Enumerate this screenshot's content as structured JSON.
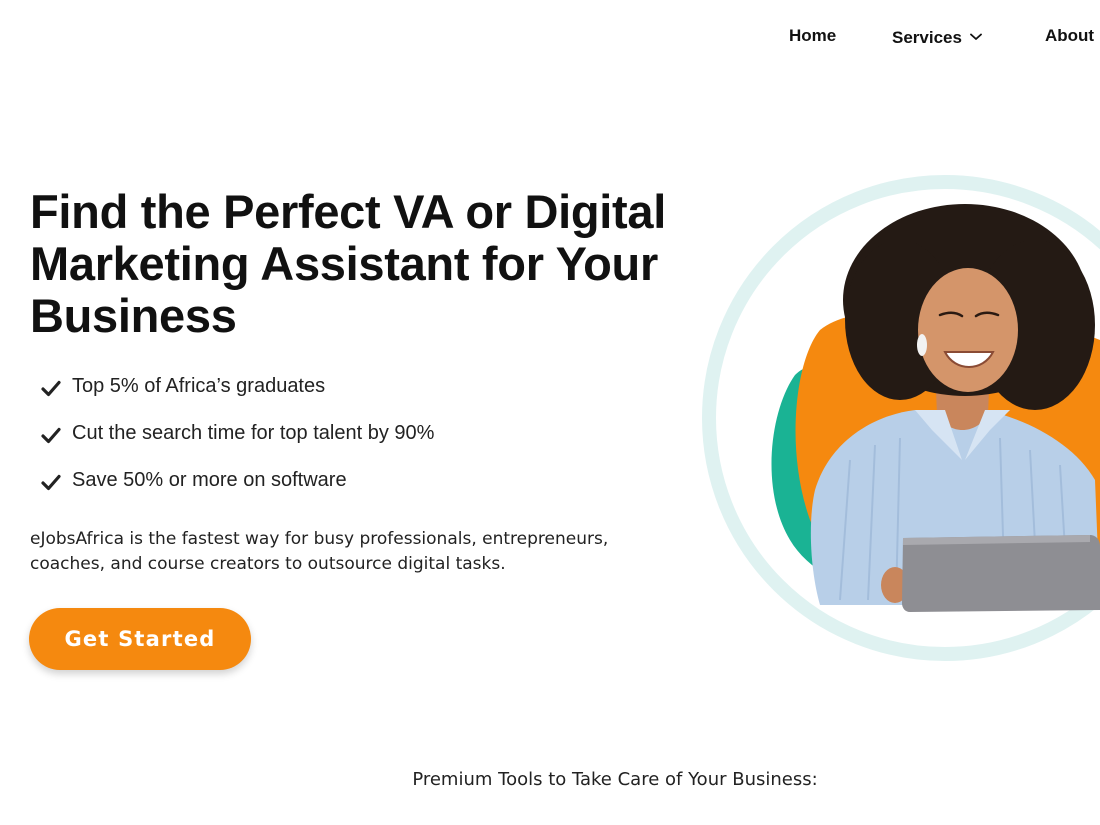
{
  "nav": {
    "items": [
      {
        "label": "Home"
      },
      {
        "label": "Services"
      },
      {
        "label": "About"
      }
    ],
    "services_icon": "chevron-down-icon"
  },
  "hero": {
    "headline_lines": [
      "Find the Perfect VA or Digital",
      "Marketing Assistant for Your",
      "Business"
    ],
    "features": [
      "Top 5% of Africa’s graduates",
      "Cut the search time for top talent by 90%",
      "Save 50% or more on software"
    ],
    "feature_icon": "check-icon",
    "description": "eJobsAfrica is the fastest way for busy professionals, entrepreneurs, coaches, and course creators to outsource digital tasks.",
    "cta_label": "Get Started",
    "image_icon": "woman-with-laptop-photo"
  },
  "section": {
    "premium_title": "Premium Tools to Take Care of Your Business:"
  },
  "colors": {
    "accent_orange": "#f5890f",
    "teal": "#1ab394",
    "ring": "#dff2f1",
    "text": "#111111"
  }
}
